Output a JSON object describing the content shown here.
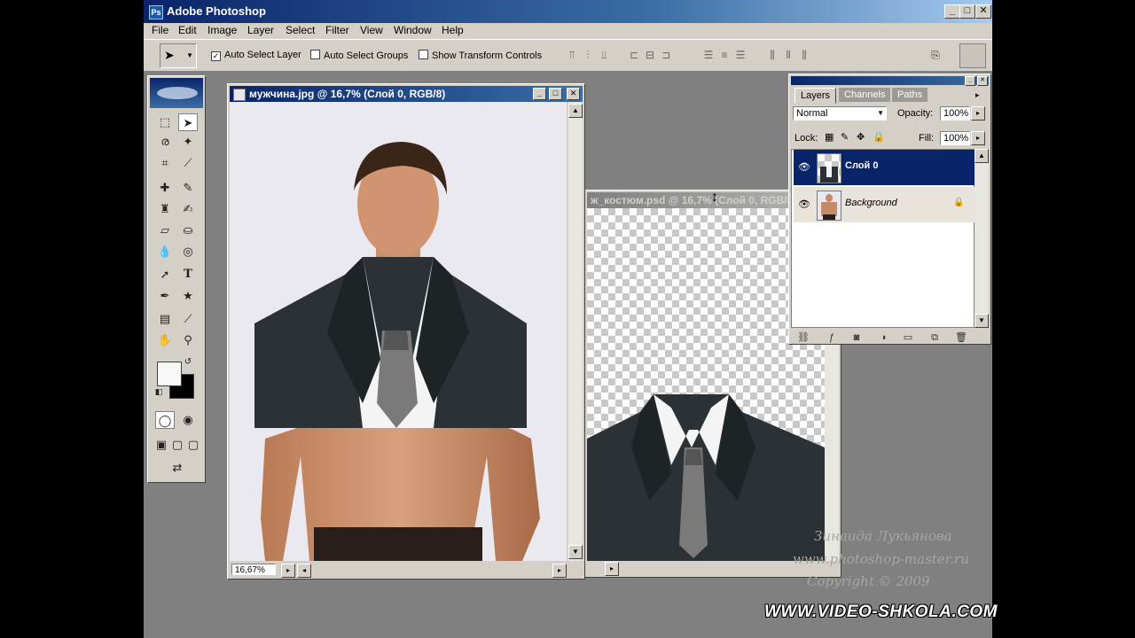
{
  "app": {
    "title": "Adobe Photoshop",
    "window_buttons": [
      "_",
      "□",
      "✕"
    ]
  },
  "menu": [
    "File",
    "Edit",
    "Image",
    "Layer",
    "Select",
    "Filter",
    "View",
    "Window",
    "Help"
  ],
  "options": {
    "auto_select_layer": {
      "label": "Auto Select Layer",
      "checked": true
    },
    "auto_select_groups": {
      "label": "Auto Select Groups",
      "checked": false
    },
    "show_transform_controls": {
      "label": "Show Transform Controls",
      "checked": false
    }
  },
  "doc1": {
    "title": "мужчина.jpg @ 16,7% (Слой 0, RGB/8)",
    "zoom": "16,67%"
  },
  "doc2": {
    "title": "ж_костюм.psd @ 16,7% (Слой 0, RGB/8)"
  },
  "layers_panel": {
    "tabs": [
      "Layers",
      "Channels",
      "Paths"
    ],
    "blend_mode": "Normal",
    "opacity_label": "Opacity:",
    "opacity": "100%",
    "lock_label": "Lock:",
    "fill_label": "Fill:",
    "fill": "100%",
    "layers": [
      {
        "name": "Слой 0",
        "selected": true
      },
      {
        "name": "Background",
        "selected": false
      }
    ]
  },
  "watermark": {
    "author": "Зинаида Лукьянова",
    "site": "www.photoshop-master.ru",
    "copyright": "Copyright © 2009"
  },
  "brand": "WWW.VIDEO-SHKOLA.COM",
  "colors": {
    "titlebar_active": "#0a246a",
    "panel_bg": "#d4d0c8",
    "workspace": "#808080",
    "layer_selected": "#0a246a"
  }
}
